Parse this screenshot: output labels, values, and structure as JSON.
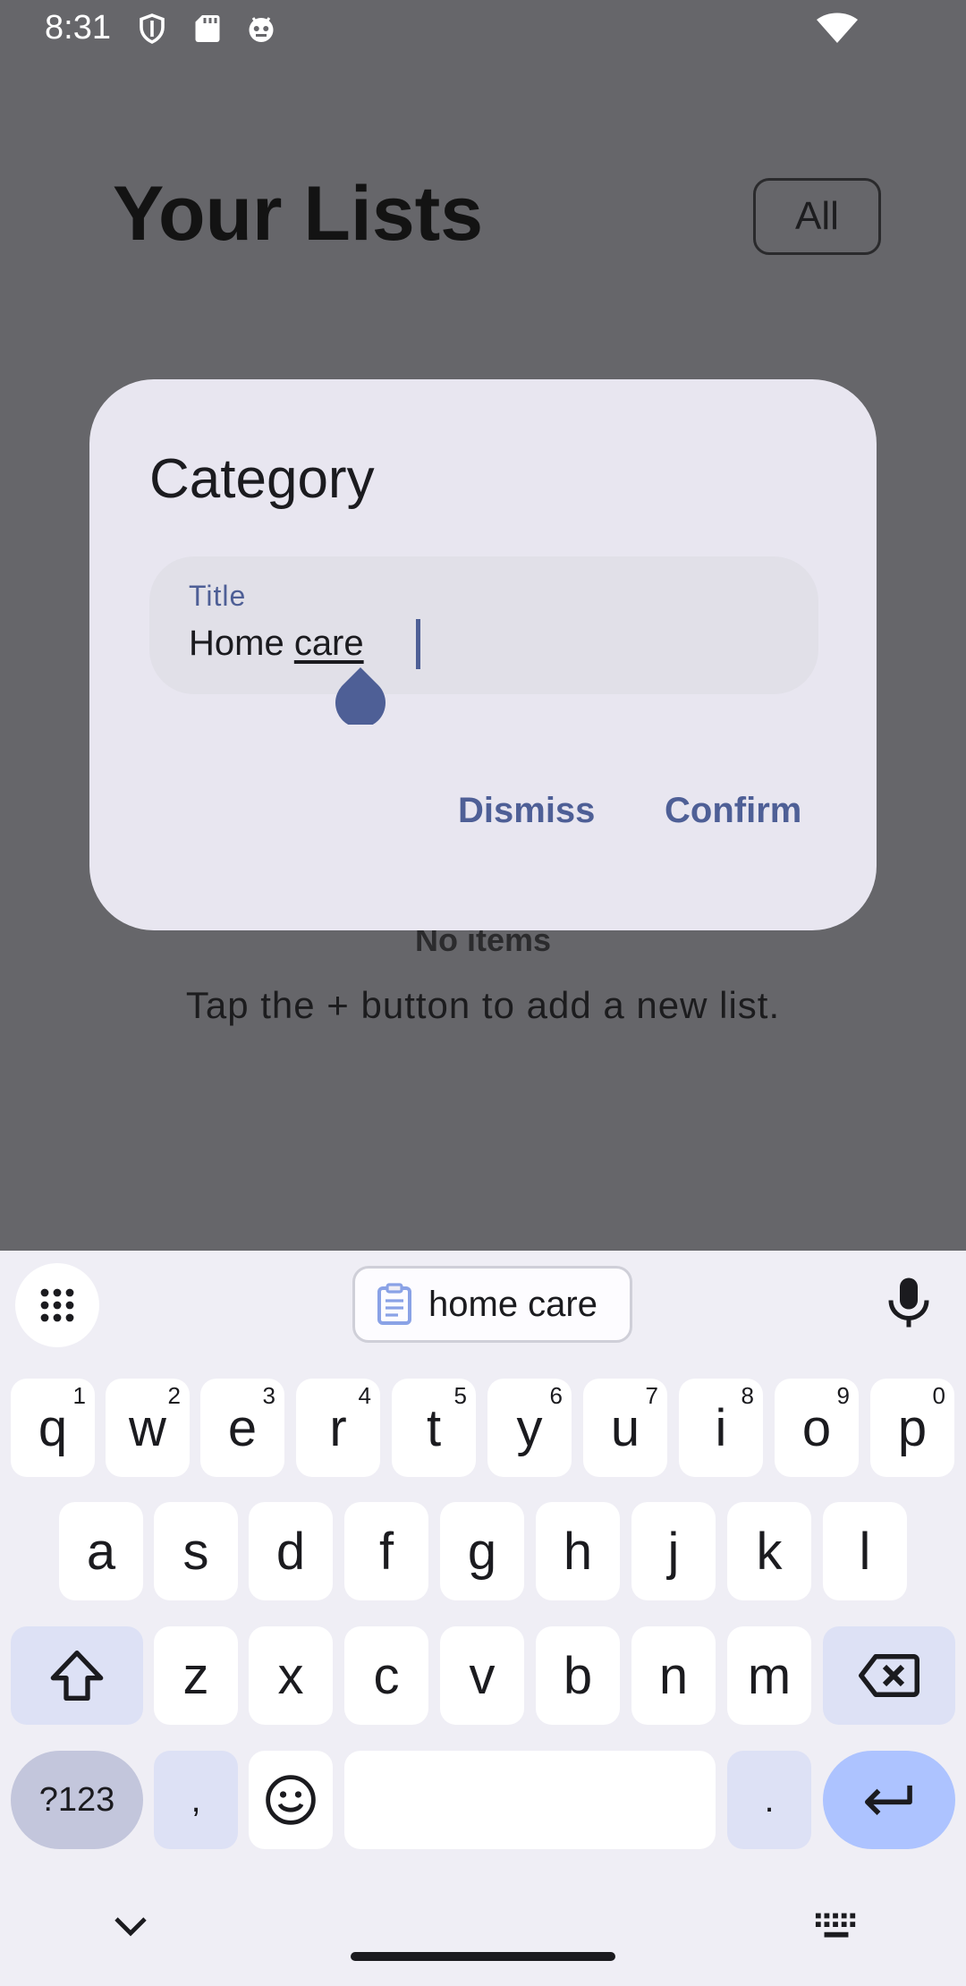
{
  "status_bar": {
    "time": "8:31",
    "icons": [
      "shield-icon",
      "sd-card-icon",
      "robot-icon",
      "wifi-icon"
    ]
  },
  "screen": {
    "title": "Your Lists",
    "filter_chip": "All",
    "empty_title": "No items",
    "empty_subtitle": "Tap the + button to add a new list."
  },
  "dialog": {
    "title": "Category",
    "field": {
      "label": "Title",
      "value_prefix": "Home ",
      "value_underlined": "care"
    },
    "dismiss_label": "Dismiss",
    "confirm_label": "Confirm"
  },
  "keyboard": {
    "clipboard_suggestion": "home care",
    "row1": [
      {
        "k": "q",
        "h": "1"
      },
      {
        "k": "w",
        "h": "2"
      },
      {
        "k": "e",
        "h": "3"
      },
      {
        "k": "r",
        "h": "4"
      },
      {
        "k": "t",
        "h": "5"
      },
      {
        "k": "y",
        "h": "6"
      },
      {
        "k": "u",
        "h": "7"
      },
      {
        "k": "i",
        "h": "8"
      },
      {
        "k": "o",
        "h": "9"
      },
      {
        "k": "p",
        "h": "0"
      }
    ],
    "row2": [
      "a",
      "s",
      "d",
      "f",
      "g",
      "h",
      "j",
      "k",
      "l"
    ],
    "row3": [
      "z",
      "x",
      "c",
      "v",
      "b",
      "n",
      "m"
    ],
    "symbols_label": "?123",
    "comma": ",",
    "period": "."
  },
  "colors": {
    "accent": "#4e5f96",
    "scrim": "#66666a",
    "dialog_bg": "#e8e6f0",
    "enter_key": "#adc3ff"
  }
}
